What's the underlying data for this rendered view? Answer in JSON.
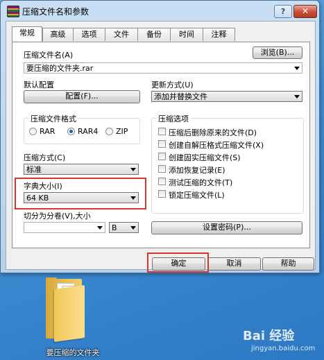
{
  "window": {
    "title": "压缩文件名和参数",
    "help_label": "?",
    "close_label": "✕"
  },
  "tabs": [
    "常规",
    "高级",
    "选项",
    "文件",
    "备份",
    "时间",
    "注释"
  ],
  "archive": {
    "name_label": "压缩文件名(A)",
    "browse_label": "浏览(B)...",
    "name_value": "要压缩的文件夹.rar"
  },
  "profile": {
    "label": "默认配置",
    "button_label": "配置(F)..."
  },
  "update": {
    "label": "更新方式(U)",
    "value": "添加并替换文件"
  },
  "format": {
    "title": "压缩文件格式",
    "options": [
      "RAR",
      "RAR4",
      "ZIP"
    ],
    "selected": "RAR4"
  },
  "method": {
    "label": "压缩方式(C)",
    "value": "标准"
  },
  "dictionary": {
    "label": "字典大小(I)",
    "value": "64 KB"
  },
  "split": {
    "label": "切分为分卷(V),大小",
    "value": "",
    "unit": "B"
  },
  "options": {
    "title": "压缩选项",
    "items": [
      "压缩后删除原来的文件(D)",
      "创建自解压格式压缩文件(X)",
      "创建固实压缩文件(S)",
      "添加恢复记录(E)",
      "测试压缩的文件(T)",
      "锁定压缩文件(L)"
    ]
  },
  "password_label": "设置密码(P)...",
  "footer": {
    "ok_label": "确定",
    "cancel_label": "取消",
    "help_label": "帮助"
  },
  "desktop": {
    "folder_label": "要压缩的文件夹",
    "watermark": "Bai 经验",
    "watermark_url": "jingyan.baidu.com"
  },
  "colors": {
    "highlight": "#d9342b",
    "selected_radio": "#1c5fb8"
  }
}
